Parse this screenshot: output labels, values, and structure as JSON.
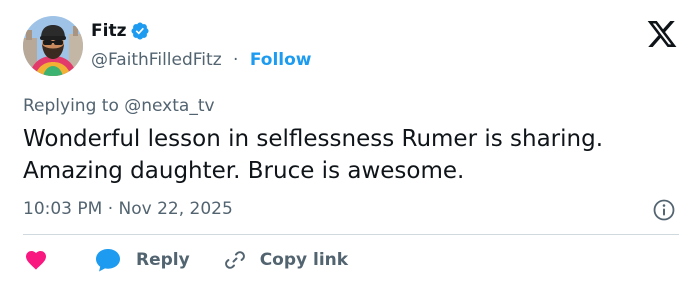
{
  "user": {
    "display_name": "Fitz",
    "handle": "@FaithFilledFitz",
    "separator": "·",
    "follow_label": "Follow",
    "verified_icon": "verified-badge-icon"
  },
  "tweet": {
    "replying_to": "Replying to @nexta_tv",
    "text": "Wonderful lesson in selflessness Rumer is sharing. Amazing daughter. Bruce is awesome.",
    "timestamp": "10:03 PM · Nov 22, 2025"
  },
  "actions": {
    "like_icon": "heart-icon",
    "reply_icon": "speech-bubble-icon",
    "reply_label": "Reply",
    "copy_icon": "link-icon",
    "copy_label": "Copy link"
  },
  "colors": {
    "accent": "#1d9bf0",
    "like": "#f91880",
    "text": "#0f1419",
    "secondary": "#536471",
    "divider": "#cfd9de"
  }
}
